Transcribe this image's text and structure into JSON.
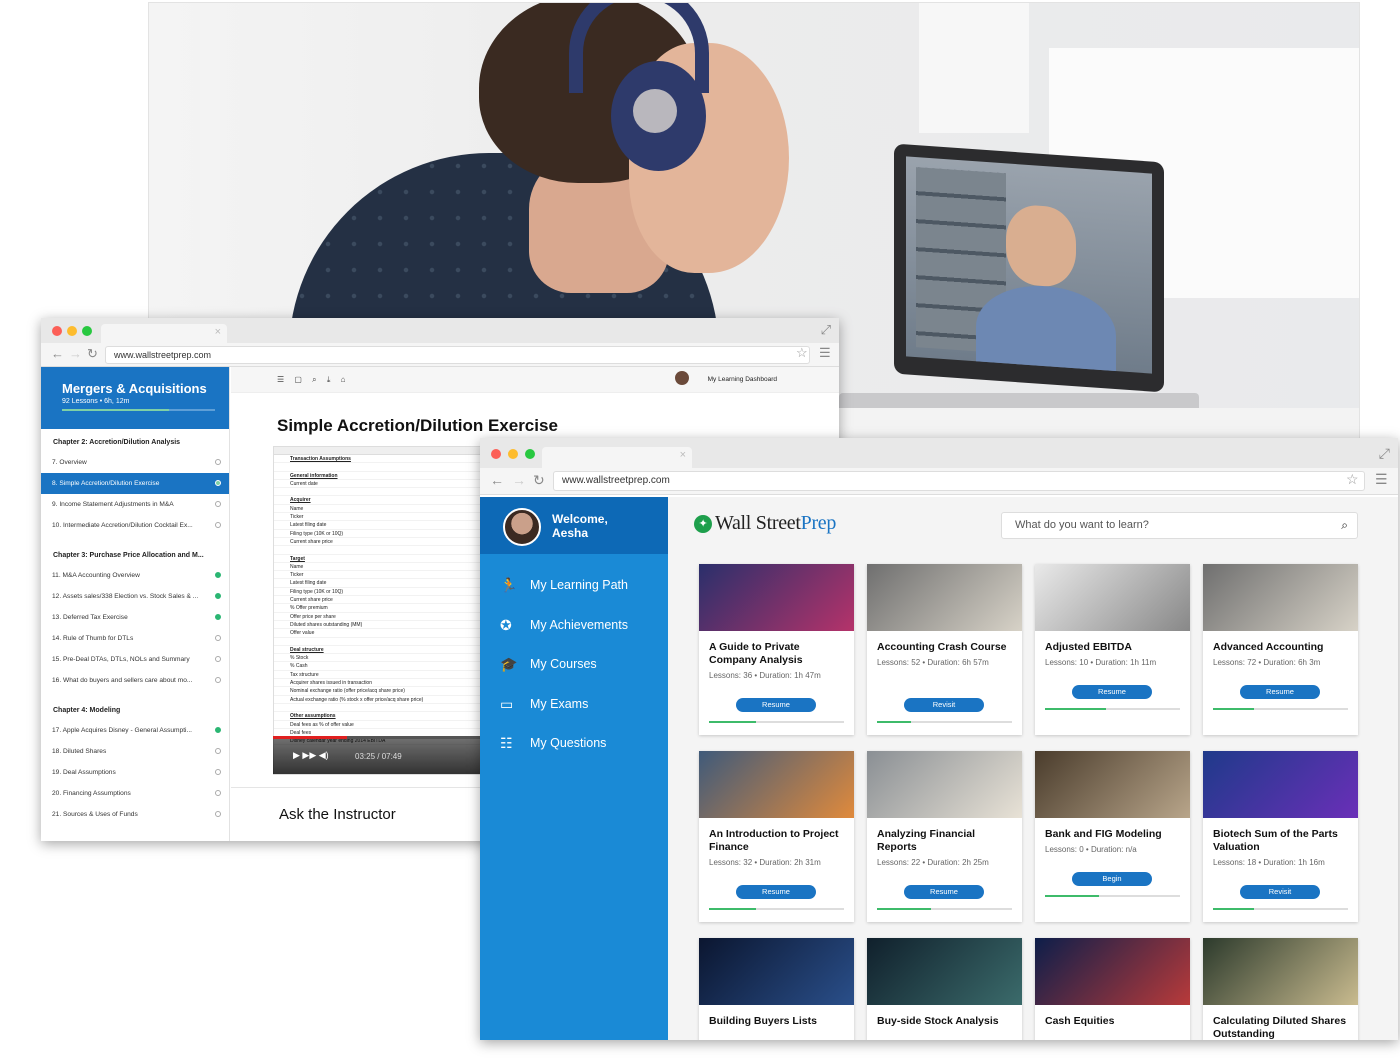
{
  "browser": {
    "url": "www.wallstreetprep.com",
    "url_inner": "www.wallstreetprep.com"
  },
  "course_window": {
    "course_title": "Mergers & Acquisitions",
    "course_meta": "92 Lessons • 6h, 12m",
    "chapters": [
      {
        "title": "Chapter 2: Accretion/Dilution Analysis",
        "lessons": [
          {
            "label": "7. Overview",
            "status": "todo"
          },
          {
            "label": "8. Simple Accretion/Dilution Exercise",
            "status": "active"
          },
          {
            "label": "9. Income Statement Adjustments in M&A",
            "status": "todo"
          },
          {
            "label": "10. Intermediate Accretion/Dilution Cocktail Ex...",
            "status": "todo"
          }
        ]
      },
      {
        "title": "Chapter 3: Purchase Price Allocation and M...",
        "lessons": [
          {
            "label": "11. M&A Accounting Overview",
            "status": "done"
          },
          {
            "label": "12. Assets sales/338 Election vs. Stock Sales & ...",
            "status": "done"
          },
          {
            "label": "13. Deferred Tax Exercise",
            "status": "done"
          },
          {
            "label": "14. Rule of Thumb for DTLs",
            "status": "todo"
          },
          {
            "label": "15. Pre-Deal DTAs, DTLs, NOLs and Summary",
            "status": "todo"
          },
          {
            "label": "16. What do buyers and sellers care about mo...",
            "status": "todo"
          }
        ]
      },
      {
        "title": "Chapter 4: Modeling",
        "lessons": [
          {
            "label": "17. Apple Acquires Disney - General Assumpti...",
            "status": "done"
          },
          {
            "label": "18. Diluted Shares",
            "status": "todo"
          },
          {
            "label": "19. Deal Assumptions",
            "status": "todo"
          },
          {
            "label": "20. Financing Assumptions",
            "status": "todo"
          },
          {
            "label": "21. Sources & Uses of Funds",
            "status": "todo"
          }
        ]
      }
    ],
    "dashboard_link": "My Learning Dashboard",
    "lesson_title": "Simple Accretion/Dilution Exercise",
    "sheet_rows": [
      {
        "text": "Transaction Assumptions",
        "bold": true
      },
      {
        "text": "",
        "bold": false
      },
      {
        "text": "General information",
        "bold": true
      },
      {
        "text": "Current date",
        "bold": false
      },
      {
        "text": "",
        "bold": false
      },
      {
        "text": "Acquirer",
        "bold": true
      },
      {
        "text": "Name",
        "bold": false
      },
      {
        "text": "Ticker",
        "bold": false
      },
      {
        "text": "Latest filing date",
        "bold": false
      },
      {
        "text": "Filing type (10K or 10Q)",
        "bold": false
      },
      {
        "text": "Current share price",
        "bold": false
      },
      {
        "text": "",
        "bold": false
      },
      {
        "text": "Target",
        "bold": true
      },
      {
        "text": "Name",
        "bold": false
      },
      {
        "text": "Ticker",
        "bold": false
      },
      {
        "text": "Latest filing date",
        "bold": false
      },
      {
        "text": "Filing type (10K or 10Q)",
        "bold": false
      },
      {
        "text": "Current share price",
        "bold": false
      },
      {
        "text": "% Offer premium",
        "bold": false
      },
      {
        "text": "Offer price per share",
        "bold": false
      },
      {
        "text": "Diluted shares outstanding (MM)",
        "bold": false
      },
      {
        "text": "Offer value",
        "bold": false
      },
      {
        "text": "",
        "bold": false
      },
      {
        "text": "Deal structure",
        "bold": true
      },
      {
        "text": "% Stock",
        "bold": false
      },
      {
        "text": "% Cash",
        "bold": false
      },
      {
        "text": "Tax structure",
        "bold": false
      },
      {
        "text": "Acquirer shares issued in transaction",
        "bold": false
      },
      {
        "text": "Nominal exchange ratio (offer price/acq share price)",
        "bold": false
      },
      {
        "text": "Actual exchange ratio (% stock x offer price/acq share price)",
        "bold": false
      },
      {
        "text": "",
        "bold": false
      },
      {
        "text": "Other assumptions",
        "bold": true
      },
      {
        "text": "Deal fees as % of offer value",
        "bold": false
      },
      {
        "text": "Deal fees",
        "bold": false
      },
      {
        "text": "Disney calendar year ending 2014 EBITDA",
        "bold": false
      }
    ],
    "video_time": "03:25 / 07:49",
    "ask_title": "Ask the Instructor"
  },
  "dashboard": {
    "welcome": "Welcome, Aesha",
    "nav": [
      {
        "label": "My Learning Path",
        "icon": "runner-icon"
      },
      {
        "label": "My Achievements",
        "icon": "badge-icon"
      },
      {
        "label": "My Courses",
        "icon": "graduation-cap-icon"
      },
      {
        "label": "My Exams",
        "icon": "exam-icon"
      },
      {
        "label": "My Questions",
        "icon": "questions-icon"
      }
    ],
    "logo_a": "Wall Street",
    "logo_b": "Prep",
    "search_placeholder": "What do you want to learn?",
    "cards": [
      {
        "title": "A Guide to Private Company Analysis",
        "lessons": "Lessons: 36",
        "duration": "Duration: 1h 47m",
        "button": "Resume",
        "progress": 0.35,
        "colors": [
          "#2a2f6b",
          "#b5336a"
        ]
      },
      {
        "title": "Accounting Crash Course",
        "lessons": "Lessons: 52",
        "duration": "Duration: 6h 57m",
        "button": "Revisit",
        "progress": 0.25,
        "colors": [
          "#6f6f6f",
          "#d7d2c7"
        ]
      },
      {
        "title": "Adjusted EBITDA",
        "lessons": "Lessons: 10",
        "duration": "Duration: 1h 11m",
        "button": "Resume",
        "progress": 0.45,
        "colors": [
          "#e9e9e9",
          "#888888"
        ]
      },
      {
        "title": "Advanced Accounting",
        "lessons": "Lessons: 72",
        "duration": "Duration: 6h 3m",
        "button": "Resume",
        "progress": 0.3,
        "colors": [
          "#6f6f6f",
          "#d7d2c7"
        ]
      },
      {
        "title": "An Introduction to Project Finance",
        "lessons": "Lessons: 32",
        "duration": "Duration: 2h 31m",
        "button": "Resume",
        "progress": 0.35,
        "colors": [
          "#3f5a7a",
          "#e08a3c"
        ]
      },
      {
        "title": "Analyzing Financial Reports",
        "lessons": "Lessons: 22",
        "duration": "Duration: 2h 25m",
        "button": "Resume",
        "progress": 0.4,
        "colors": [
          "#8a8f94",
          "#e8e2d6"
        ]
      },
      {
        "title": "Bank and FIG Modeling",
        "lessons": "Lessons: 0",
        "duration": "Duration: n/a",
        "button": "Begin",
        "progress": 0.4,
        "colors": [
          "#4a3c2c",
          "#b8a58a"
        ]
      },
      {
        "title": "Biotech Sum of the Parts Valuation",
        "lessons": "Lessons: 18",
        "duration": "Duration: 1h 16m",
        "button": "Revisit",
        "progress": 0.3,
        "colors": [
          "#1f3a8a",
          "#6a2fb8"
        ]
      },
      {
        "title": "Building Buyers Lists",
        "lessons": "",
        "duration": "",
        "button": "",
        "progress": 0,
        "colors": [
          "#0b1630",
          "#2a4f8a"
        ]
      },
      {
        "title": "Buy-side Stock Analysis",
        "lessons": "",
        "duration": "",
        "button": "",
        "progress": 0,
        "colors": [
          "#10202c",
          "#3b6b6b"
        ]
      },
      {
        "title": "Cash Equities",
        "lessons": "",
        "duration": "",
        "button": "",
        "progress": 0,
        "colors": [
          "#0d1e4a",
          "#b83a3a"
        ]
      },
      {
        "title": "Calculating Diluted Shares Outstanding",
        "lessons": "",
        "duration": "",
        "button": "",
        "progress": 0,
        "colors": [
          "#2c3a2c",
          "#c9bb8f"
        ]
      }
    ]
  }
}
